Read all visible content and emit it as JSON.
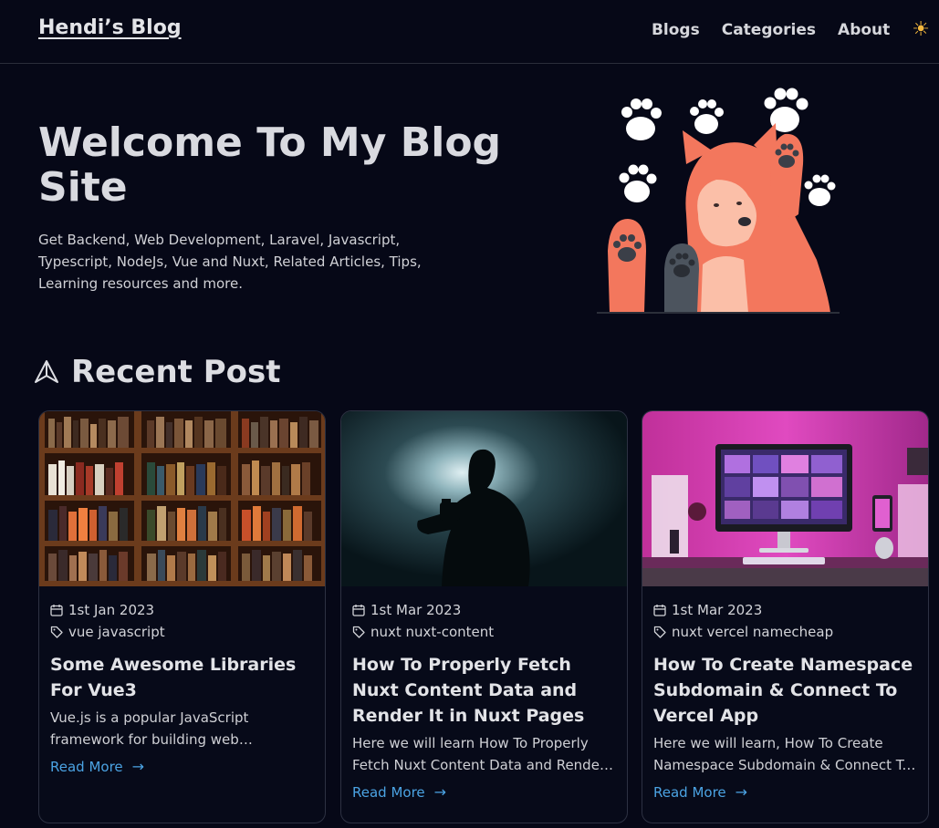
{
  "header": {
    "brand": "Hendi’s Blog",
    "nav": [
      "Blogs",
      "Categories",
      "About"
    ],
    "theme_icon": "sun-icon"
  },
  "hero": {
    "title": "Welcome To My Blog Site",
    "subtitle": "Get Backend, Web Development, Laravel, Javascript, Typescript, NodeJs, Vue and Nuxt, Related Articles, Tips, Learning resources and more."
  },
  "recent": {
    "title": "Recent Post",
    "icon": "arrow-up-icon"
  },
  "posts": [
    {
      "date": "1st Jan 2023",
      "tags": "vue javascript",
      "title": "Some Awesome Libraries For Vue3",
      "description": "Vue.js is a popular JavaScript framework for building web applications.",
      "read_more": "Read More"
    },
    {
      "date": "1st Mar 2023",
      "tags": "nuxt nuxt-content",
      "title": "How To Properly Fetch Nuxt Content Data and Render It in Nuxt Pages",
      "description": "Here we will learn How To Properly Fetch Nuxt Content Data and Render It in Nuxt Pages",
      "read_more": "Read More"
    },
    {
      "date": "1st Mar 2023",
      "tags": "nuxt vercel namecheap",
      "title": "How To Create Namespace Subdomain & Connect To Vercel App",
      "description": "Here we will learn, How To Create Namespace Subdomain & Connect To Vercel App",
      "read_more": "Read More"
    }
  ],
  "colors": {
    "background": "#060817",
    "link": "#4ba3e3",
    "sun": "#f5b83d"
  }
}
